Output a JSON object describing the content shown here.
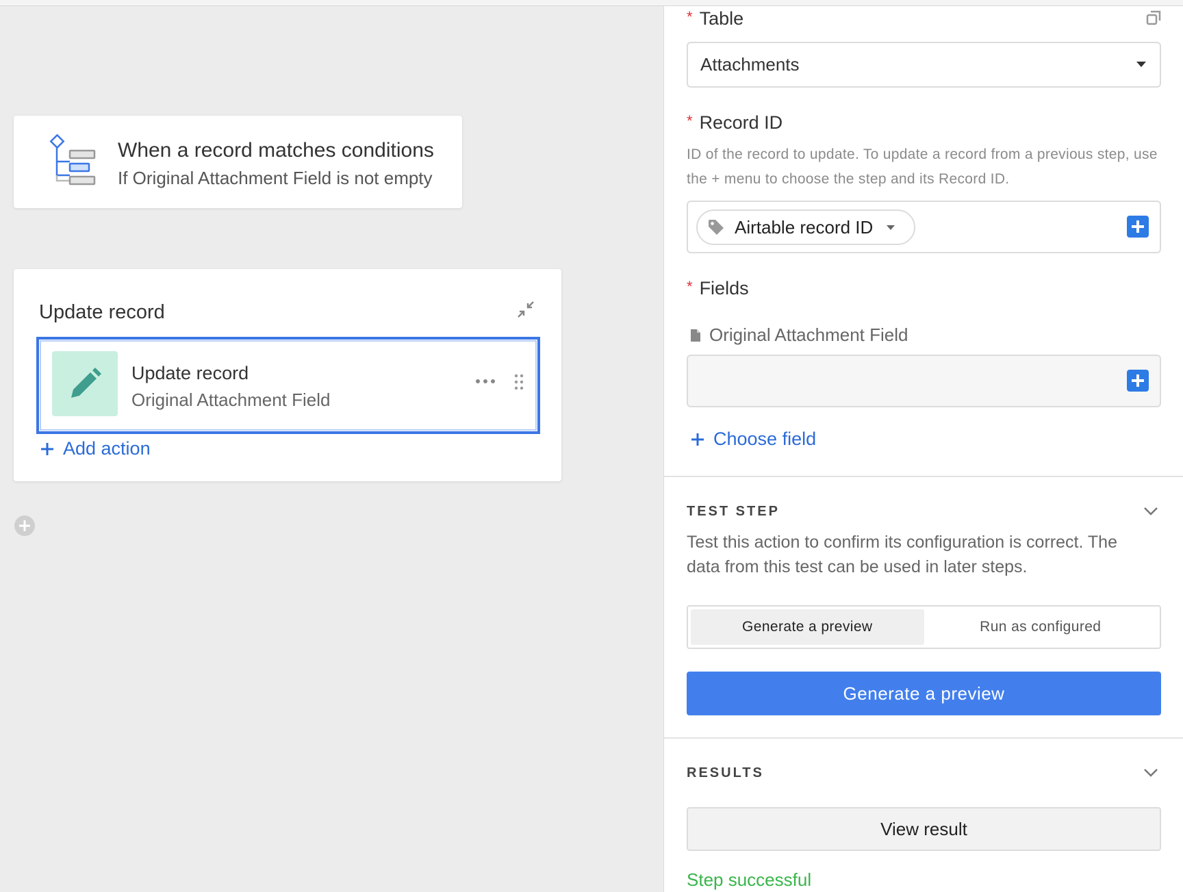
{
  "canvas": {
    "trigger": {
      "title": "When a record matches conditions",
      "subtitle": "If Original Attachment Field is not empty",
      "icon": "conditions-tree-icon"
    },
    "action_group": {
      "title": "Update record",
      "action": {
        "title": "Update record",
        "subtitle": "Original Attachment Field",
        "icon": "pencil-icon"
      },
      "add_action_label": "Add action"
    }
  },
  "panel": {
    "table": {
      "label": "Table",
      "value": "Attachments"
    },
    "record_id": {
      "label": "Record ID",
      "help": "ID of the record to update. To update a record from a previous step, use the + menu to choose the step and its Record ID.",
      "token": "Airtable record ID"
    },
    "fields": {
      "label": "Fields",
      "field_name": "Original Attachment Field",
      "choose_field_label": "Choose field"
    },
    "test_step": {
      "title": "TEST STEP",
      "description": "Test this action to confirm its configuration is correct. The data from this test can be used in later steps.",
      "options": [
        "Generate a preview",
        "Run as configured"
      ],
      "selected_option": "Generate a preview",
      "button_label": "Generate a preview"
    },
    "results": {
      "title": "RESULTS",
      "view_result_label": "View result",
      "status": "Step successful"
    }
  },
  "colors": {
    "accent": "#427fec",
    "link": "#2b6bd8",
    "required": "#e0313b",
    "success": "#39b54a",
    "action_icon_bg": "#c9efe0"
  }
}
